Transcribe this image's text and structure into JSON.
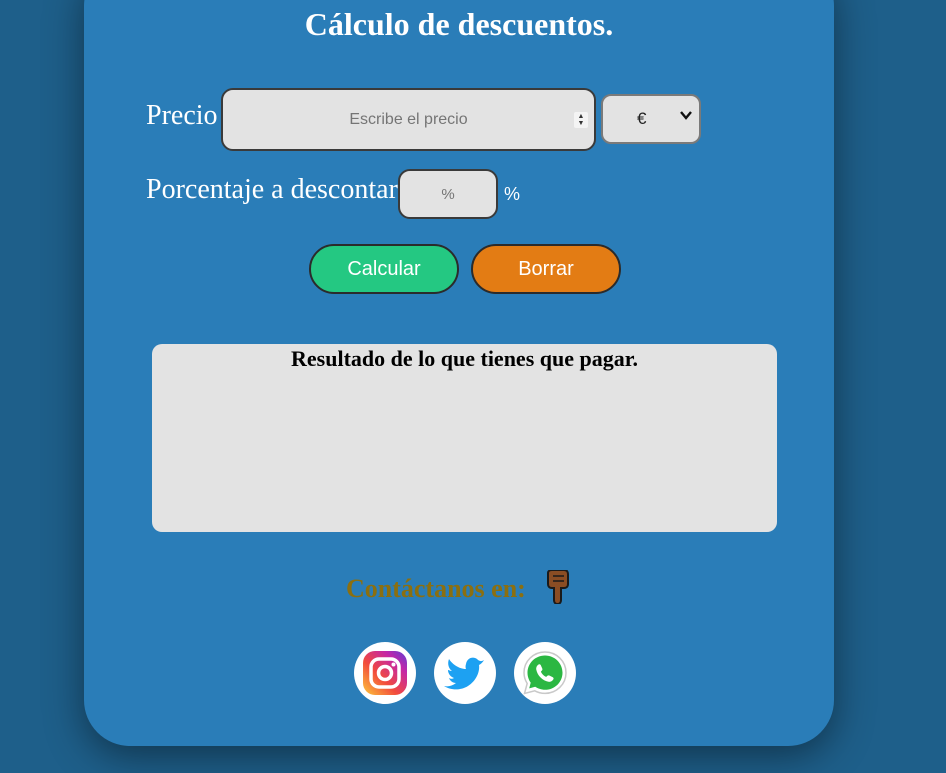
{
  "title": "Cálculo de descuentos.",
  "form": {
    "precio_label": "Precio",
    "precio_placeholder": "Escribe el precio",
    "currency_selected": "€",
    "porcentaje_label": "Porcentaje a descontar",
    "porcentaje_placeholder": "%",
    "porcentaje_suffix": "%"
  },
  "buttons": {
    "calcular": "Calcular",
    "borrar": "Borrar"
  },
  "result": {
    "title": "Resultado de lo que tienes que pagar."
  },
  "contact": {
    "label": "Contáctanos en:",
    "pointer_icon": "pointing-down-hand-icon",
    "social": [
      {
        "icon": "instagram-icon"
      },
      {
        "icon": "twitter-icon"
      },
      {
        "icon": "whatsapp-icon"
      }
    ]
  },
  "colors": {
    "background": "#1e5f8a",
    "card": "#2a7db8",
    "calcular_button": "#24c882",
    "borrar_button": "#e37c14",
    "contact_text": "#8b6f10"
  }
}
